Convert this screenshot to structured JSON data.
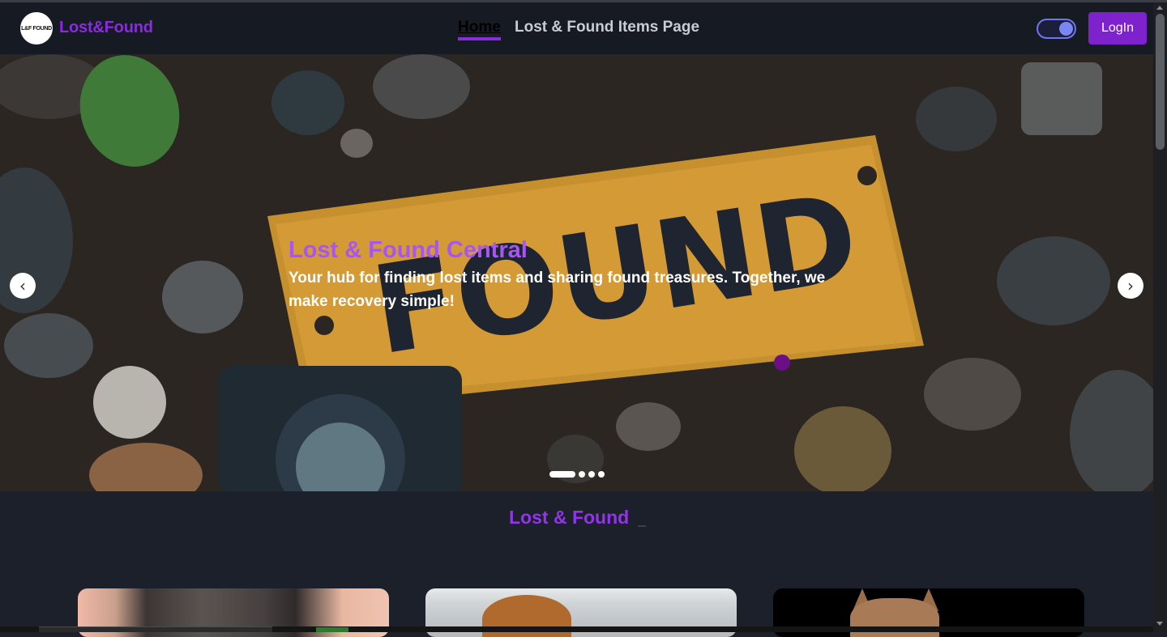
{
  "navbar": {
    "logo_text": "L&F FOUND",
    "brand": "Lost&Found",
    "links": [
      "Home",
      "Lost & Found Items Page"
    ],
    "login_label": "LogIn",
    "theme_toggle": "dark-mode-toggle"
  },
  "hero": {
    "image_sign_text": "FOUND",
    "title": "Lost & Found Central",
    "subtitle": "Your hub for finding lost items and sharing found treasures. Together, we make recovery simple!",
    "prev_icon": "chevron-left-icon",
    "next_icon": "chevron-right-icon",
    "slides_total": 4,
    "active_slide": 1
  },
  "section": {
    "title": "Lost & Found"
  },
  "cards": [
    {
      "image": "person-with-bag-photo"
    },
    {
      "image": "puppy-photo"
    },
    {
      "image": "cat-photo"
    }
  ],
  "colors": {
    "accent": "#7e22ce",
    "brand": "#8a2be2",
    "title": "#a855f7",
    "background": "#1b202a",
    "navbar": "#161a22"
  }
}
